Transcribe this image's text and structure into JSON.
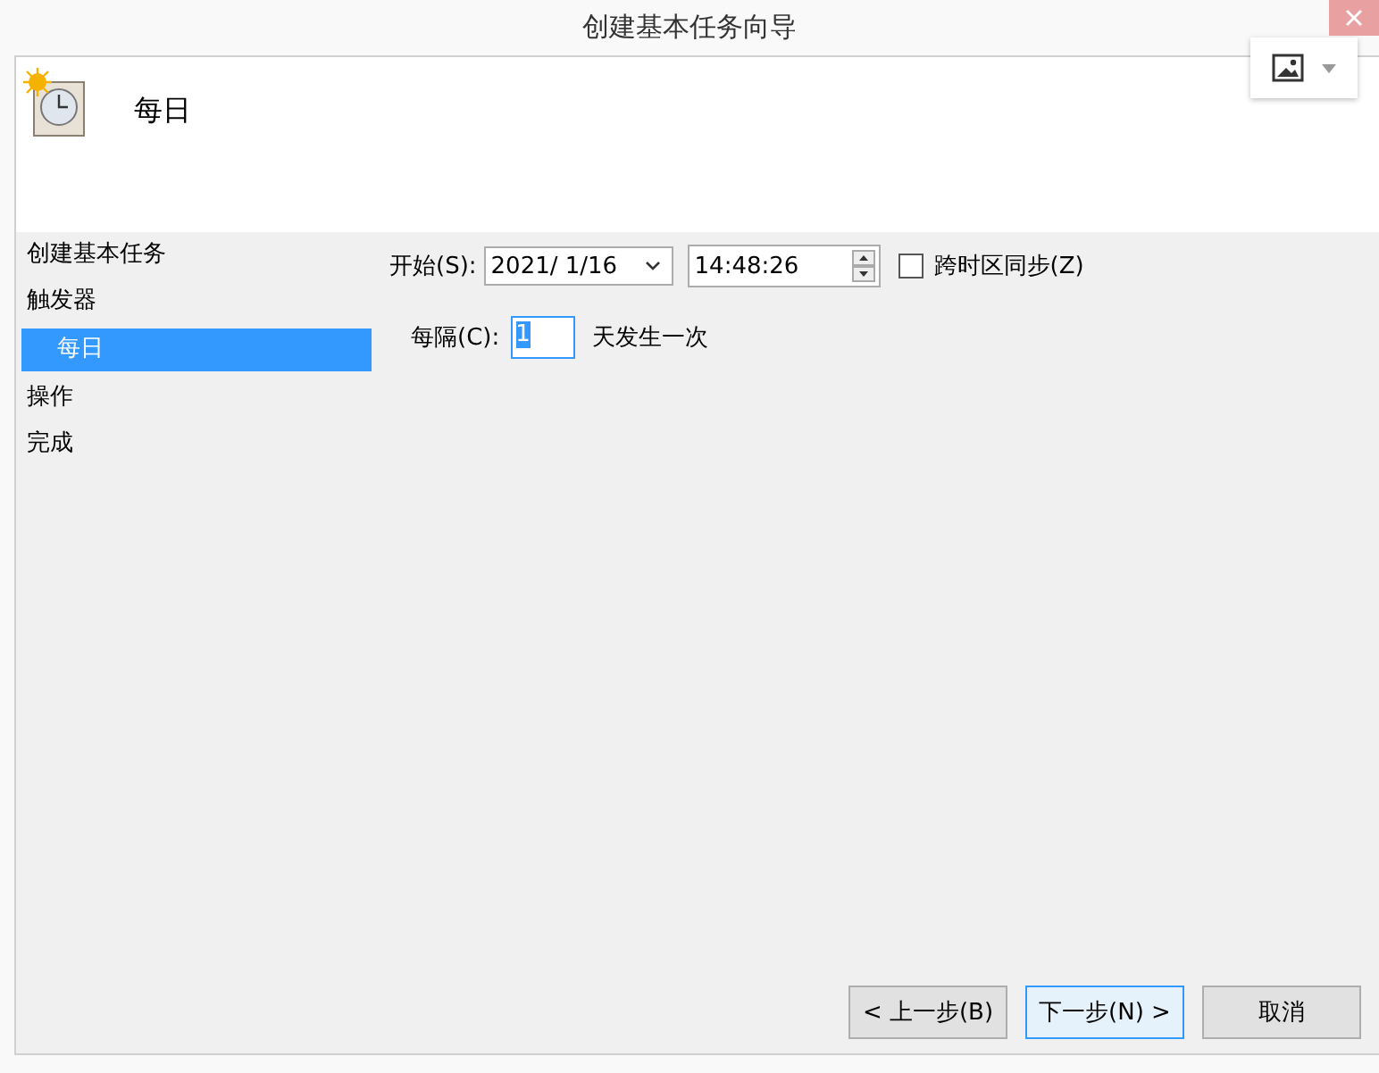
{
  "window": {
    "title": "创建基本任务向导"
  },
  "header": {
    "title": "每日"
  },
  "sidebar": {
    "items": [
      {
        "label": "创建基本任务",
        "selected": false
      },
      {
        "label": "触发器",
        "selected": false,
        "children": [
          {
            "label": "每日",
            "selected": true
          }
        ]
      },
      {
        "label": "操作",
        "selected": false
      },
      {
        "label": "完成",
        "selected": false
      }
    ]
  },
  "form": {
    "start_label": "开始(S):",
    "date": "2021/  1/16",
    "time": "14:48:26",
    "sync": {
      "label": "跨时区同步(Z)",
      "checked": false
    },
    "interval_label": "每隔(C):",
    "interval": "1",
    "interval_suffix": "天发生一次"
  },
  "buttons": [
    {
      "label": "< 上一步(B)",
      "selected": false
    },
    {
      "label": "下一步(N) >",
      "selected": true
    },
    {
      "label": "取消",
      "selected": false
    }
  ]
}
